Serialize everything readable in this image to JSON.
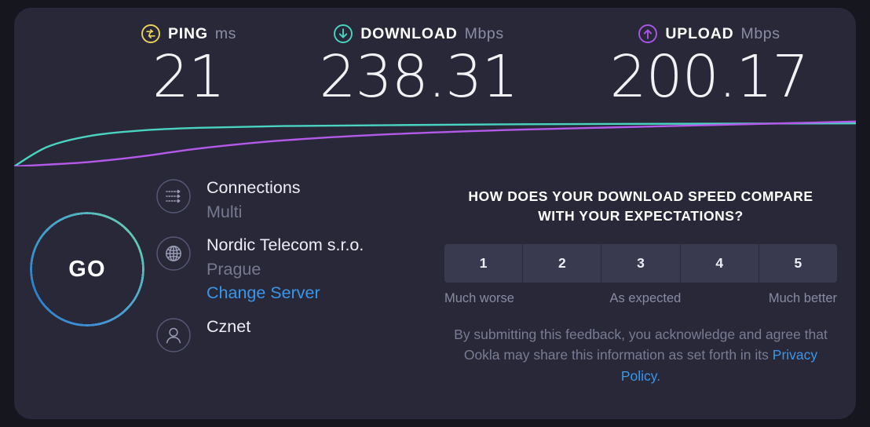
{
  "theme": {
    "page_bg": "#16161f",
    "card_bg": "#282839",
    "ping_accent": "#e8d45a",
    "download_accent": "#4ad3c0",
    "upload_accent": "#a855e8",
    "link_blue": "#3b96e8",
    "muted_text": "#76798f"
  },
  "metrics": {
    "ping": {
      "icon": "ping-icon",
      "label": "PING",
      "unit": "ms",
      "value": "21"
    },
    "download": {
      "icon": "download-arrow-icon",
      "label": "DOWNLOAD",
      "unit": "Mbps",
      "value": "238.31"
    },
    "upload": {
      "icon": "upload-arrow-icon",
      "label": "UPLOAD",
      "unit": "Mbps",
      "value": "200.17"
    }
  },
  "chart_data": {
    "type": "line",
    "title": "",
    "xlabel": "",
    "ylabel": "",
    "grid": false,
    "legend": "none",
    "x": [
      0,
      0.04,
      0.09,
      0.15,
      0.22,
      0.32,
      0.45,
      0.6,
      0.78,
      1.0
    ],
    "series": [
      {
        "name": "download",
        "color": "#4ad3c0",
        "values": [
          0,
          22,
          34,
          40,
          43,
          45,
          46,
          47,
          47.5,
          48
        ]
      },
      {
        "name": "upload",
        "color": "#b45ae8",
        "values": [
          0,
          2,
          5,
          11,
          20,
          29,
          36,
          41,
          45,
          50
        ]
      }
    ],
    "ylim": [
      0,
      56
    ]
  },
  "go_button": {
    "label": "GO"
  },
  "info": {
    "connections": {
      "icon": "connections-icon",
      "primary": "Connections",
      "secondary": "Multi"
    },
    "server": {
      "icon": "globe-icon",
      "primary": "Nordic Telecom s.r.o.",
      "secondary": "Prague",
      "link": "Change Server"
    },
    "account": {
      "icon": "person-icon",
      "primary": "Cznet"
    }
  },
  "feedback": {
    "title": "HOW DOES YOUR DOWNLOAD SPEED COMPARE WITH YOUR EXPECTATIONS?",
    "ratings": [
      "1",
      "2",
      "3",
      "4",
      "5"
    ],
    "legend": {
      "low": "Much worse",
      "mid": "As expected",
      "high": "Much better"
    },
    "disclaimer_prefix": "By submitting this feedback, you acknowledge and agree that Ookla may share this information as set forth in its ",
    "disclaimer_link": "Privacy Policy",
    "disclaimer_suffix": "."
  }
}
